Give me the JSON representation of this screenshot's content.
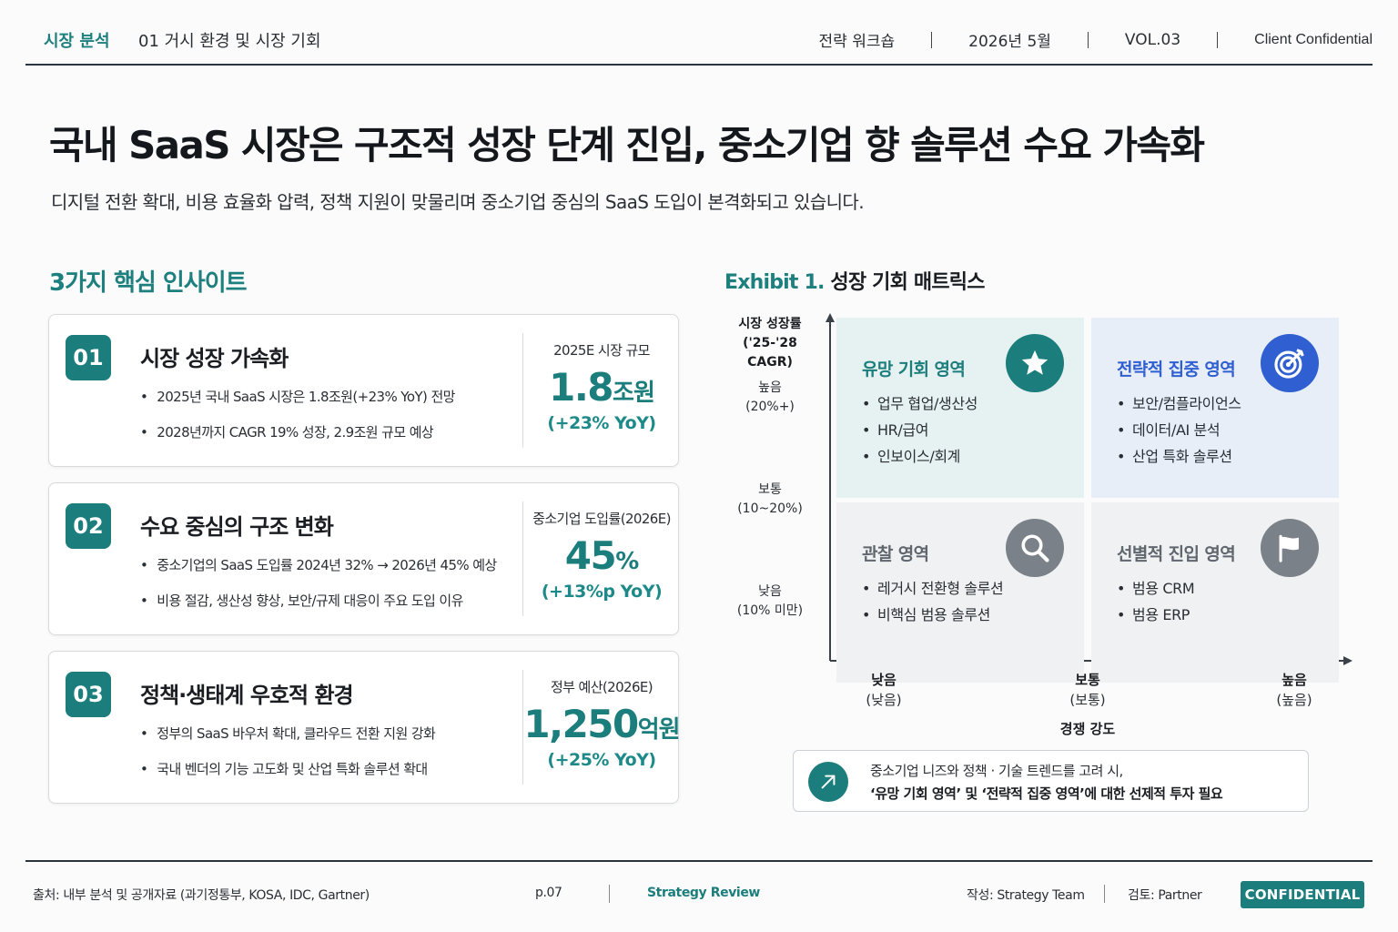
{
  "header": {
    "section": "시장 분석",
    "subsection": "01  거시 환경 및 시장 기회",
    "meta": [
      "전략 워크숍",
      "2026년 5월",
      "VOL.03",
      "Client Confidential"
    ]
  },
  "title": "국내 SaaS 시장은 구조적 성장 단계 진입, 중소기업 향 솔루션 수요 가속화",
  "subtitle": "디지털 전환 확대, 비용 효율화 압력, 정책 지원이 맞물리며 중소기업 중심의 SaaS 도입이 본격화되고 있습니다.",
  "insights": {
    "title": "3가지 핵심 인사이트",
    "cards": [
      {
        "num": "01",
        "title": "시장 성장 가속화",
        "bullets": [
          "2025년 국내 SaaS 시장은 1.8조원(+23% YoY) 전망",
          "2028년까지 CAGR 19% 성장, 2.9조원 규모 예상"
        ],
        "metric_label": "2025E 시장 규모",
        "metric_value": "1.8",
        "metric_unit": "조원",
        "metric_change": "(+23% YoY)"
      },
      {
        "num": "02",
        "title": "수요 중심의 구조 변화",
        "bullets": [
          "중소기업의 SaaS 도입률 2024년 32% → 2026년 45% 예상",
          "비용 절감, 생산성 향상, 보안/규제 대응이 주요 도입 이유"
        ],
        "metric_label": "중소기업 도입률(2026E)",
        "metric_value": "45",
        "metric_unit": "%",
        "metric_change": "(+13%p YoY)"
      },
      {
        "num": "03",
        "title": "정책·생태계 우호적 환경",
        "bullets": [
          "정부의 SaaS 바우처 확대, 클라우드 전환 지원 강화",
          "국내 벤더의 기능 고도화 및 산업 특화 솔루션 확대"
        ],
        "metric_label": "정부 예산(2026E)",
        "metric_value": "1,250",
        "metric_unit": "억원",
        "metric_change": "(+25% YoY)"
      }
    ]
  },
  "exhibit": {
    "label": "Exhibit 1.",
    "title": "성장 기회 매트릭스",
    "y_axis": {
      "title_line1": "시장 성장률",
      "title_line2": "('25-'28 CAGR)",
      "levels": [
        {
          "name": "높음",
          "range": "(20%+)"
        },
        {
          "name": "보통",
          "range": "(10~20%)"
        },
        {
          "name": "낮음",
          "range": "(10% 미만)"
        }
      ]
    },
    "x_axis": {
      "title": "경쟁 강도",
      "levels": [
        {
          "name": "낮음",
          "sub": "(낮음)"
        },
        {
          "name": "보통",
          "sub": "(보통)"
        },
        {
          "name": "높음",
          "sub": "(높음)"
        }
      ]
    },
    "quadrants": {
      "top_left": {
        "title": "유망 기회 영역",
        "items": [
          "업무 협업/생산성",
          "HR/급여",
          "인보이스/회계"
        ],
        "icon": "star-icon",
        "color": "#1b7d7c",
        "bg": "#e6f2f1"
      },
      "top_right": {
        "title": "전략적 집중 영역",
        "items": [
          "보안/컴플라이언스",
          "데이터/AI 분석",
          "산업 특화 솔루션"
        ],
        "icon": "target-icon",
        "color": "#2f5fd0",
        "bg": "#e7eef8"
      },
      "bottom_left": {
        "title": "관찰 영역",
        "items": [
          "레거시 전환형 솔루션",
          "비핵심 범용 솔루션"
        ],
        "icon": "search-icon",
        "color": "#7b8189",
        "bg": "#f0f1f2"
      },
      "bottom_right": {
        "title": "선별적 진입 영역",
        "items": [
          "범용 CRM",
          "범용 ERP"
        ],
        "icon": "flag-icon",
        "color": "#7b8189",
        "bg": "#f0f1f2"
      }
    },
    "callout": {
      "line1": "중소기업 니즈와 정책 · 기술 트렌드를 고려 시,",
      "line2": "‘유망 기회 영역’ 및 ‘전략적 집중 영역’에 대한 선제적 투자 필요"
    }
  },
  "footer": {
    "source": "출처: 내부 분석 및 공개자료 (과기정통부, KOSA, IDC, Gartner)",
    "page": "p.07",
    "brand": "Strategy Review",
    "author": "작성: Strategy Team",
    "reviewer": "검토: Partner",
    "badge": "CONFIDENTIAL"
  }
}
